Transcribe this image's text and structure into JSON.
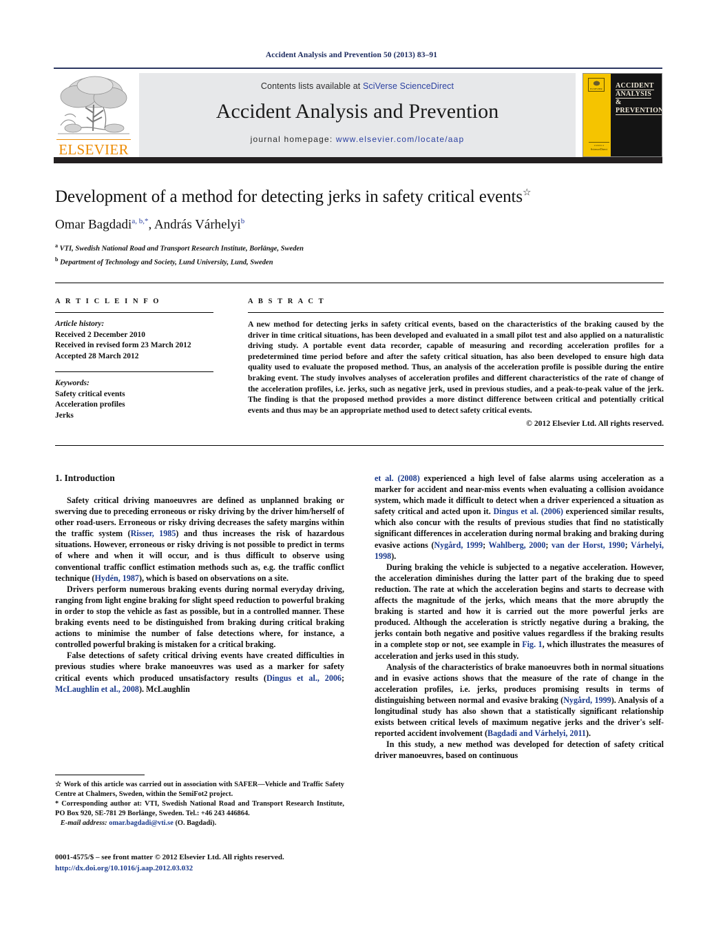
{
  "running_head": "Accident Analysis and Prevention 50 (2013) 83–91",
  "masthead": {
    "contents_prefix": "Contents lists available at ",
    "sciencedirect_link": "SciVerse ScienceDirect",
    "journal_title": "Accident Analysis and Prevention",
    "homepage_prefix": "journal homepage: ",
    "homepage_url": "www.elsevier.com/locate/aap",
    "publisher_wordmark": "ELSEVIER",
    "cover": {
      "line1": "ACCIDENT",
      "line2": "ANALYSIS",
      "line3": "&",
      "line4": "PREVENTION",
      "footer_small": "available at",
      "footer_brand": "ScienceDirect"
    }
  },
  "article": {
    "title": "Development of a method for detecting jerks in safety critical events",
    "title_footnote_mark": "☆",
    "authors": [
      {
        "name": "Omar Bagdadi",
        "marks": "a, b,*"
      },
      {
        "name": "András Várhelyi",
        "marks": "b"
      }
    ],
    "authors_line_separator": ", ",
    "affiliations": [
      {
        "mark": "a",
        "text": "VTI, Swedish National Road and Transport Research Institute, Borlänge, Sweden"
      },
      {
        "mark": "b",
        "text": "Department of Technology and Society, Lund University, Lund, Sweden"
      }
    ]
  },
  "article_info": {
    "heading": "A R T I C L E    I N F O",
    "history_label": "Article history:",
    "history": [
      "Received 2 December 2010",
      "Received in revised form 23 March 2012",
      "Accepted 28 March 2012"
    ],
    "keywords_label": "Keywords:",
    "keywords": [
      "Safety critical events",
      "Acceleration profiles",
      "Jerks"
    ]
  },
  "abstract": {
    "heading": "A B S T R A C T",
    "text": "A new method for detecting jerks in safety critical events, based on the characteristics of the braking caused by the driver in time critical situations, has been developed and evaluated in a small pilot test and also applied on a naturalistic driving study. A portable event data recorder, capable of measuring and recording acceleration profiles for a predetermined time period before and after the safety critical situation, has also been developed to ensure high data quality used to evaluate the proposed method. Thus, an analysis of the acceleration profile is possible during the entire braking event. The study involves analyses of acceleration profiles and different characteristics of the rate of change of the acceleration profiles, i.e. jerks, such as negative jerk, used in previous studies, and a peak-to-peak value of the jerk. The finding is that the proposed method provides a more distinct difference between critical and potentially critical events and thus may be an appropriate method used to detect safety critical events.",
    "copyright": "© 2012 Elsevier Ltd. All rights reserved."
  },
  "body": {
    "section_number_title": "1.  Introduction",
    "left_paragraphs": [
      "Safety critical driving manoeuvres are defined as unplanned braking or swerving due to preceding erroneous or risky driving by the driver him/herself of other road-users. Erroneous or risky driving decreases the safety margins within the traffic system (Risser, 1985) and thus increases the risk of hazardous situations. However, erroneous or risky driving is not possible to predict in terms of where and when it will occur, and is thus difficult to observe using conventional traffic conflict estimation methods such as, e.g. the traffic conflict technique (Hydén, 1987), which is based on observations on a site.",
      "Drivers perform numerous braking events during normal everyday driving, ranging from light engine braking for slight speed reduction to powerful braking in order to stop the vehicle as fast as possible, but in a controlled manner. These braking events need to be distinguished from braking during critical braking actions to minimise the number of false detections where, for instance, a controlled powerful braking is mistaken for a critical braking.",
      "False detections of safety critical driving events have created difficulties in previous studies where brake manoeuvres was used as a marker for safety critical events which produced unsatisfactory results (Dingus et al., 2006; McLaughlin et al., 2008). McLaughlin"
    ],
    "right_paragraphs": [
      "et al. (2008) experienced a high level of false alarms using acceleration as a marker for accident and near-miss events when evaluating a collision avoidance system, which made it difficult to detect when a driver experienced a situation as safety critical and acted upon it. Dingus et al. (2006) experienced similar results, which also concur with the results of previous studies that find no statistically significant differences in acceleration during normal braking and braking during evasive actions (Nygård, 1999; Wahlberg, 2000; van der Horst, 1990; Várhelyi, 1998).",
      "During braking the vehicle is subjected to a negative acceleration. However, the acceleration diminishes during the latter part of the braking due to speed reduction. The rate at which the acceleration begins and starts to decrease with affects the magnitude of the jerks, which means that the more abruptly the braking is started and how it is carried out the more powerful jerks are produced. Although the acceleration is strictly negative during a braking, the jerks contain both negative and positive values regardless if the braking results in a complete stop or not, see example in Fig. 1, which illustrates the measures of acceleration and jerks used in this study.",
      "Analysis of the characteristics of brake manoeuvres both in normal situations and in evasive actions shows that the measure of the rate of change in the acceleration profiles, i.e. jerks, produces promising results in terms of distinguishing between normal and evasive braking (Nygård, 1999). Analysis of a longitudinal study has also shown that a statistically significant relationship exists between critical levels of maximum negative jerks and the driver's self-reported accident involvement (Bagdadi and Várhelyi, 2011).",
      "In this study, a new method was developed for detection of safety critical driver manoeuvres, based on continuous"
    ]
  },
  "footnotes": {
    "star_mark": "☆",
    "star_text": " Work of this article was carried out in association with SAFER—Vehicle and Traffic Safety Centre at Chalmers, Sweden, within the SemiFot2 project.",
    "corresponding_mark": "*",
    "corresponding_text": " Corresponding author at: VTI, Swedish National Road and Transport Research Institute, PO Box 920, SE-781 29 Borlänge, Sweden. Tel.: +46 243 446864.",
    "email_label": "E-mail address:",
    "email_address": "omar.bagdadi@vti.se",
    "email_owner": "(O. Bagdadi)."
  },
  "imprint": {
    "issn_line": "0001-4575/$ – see front matter © 2012 Elsevier Ltd. All rights reserved.",
    "doi_line": "http://dx.doi.org/10.1016/j.aap.2012.03.032"
  }
}
